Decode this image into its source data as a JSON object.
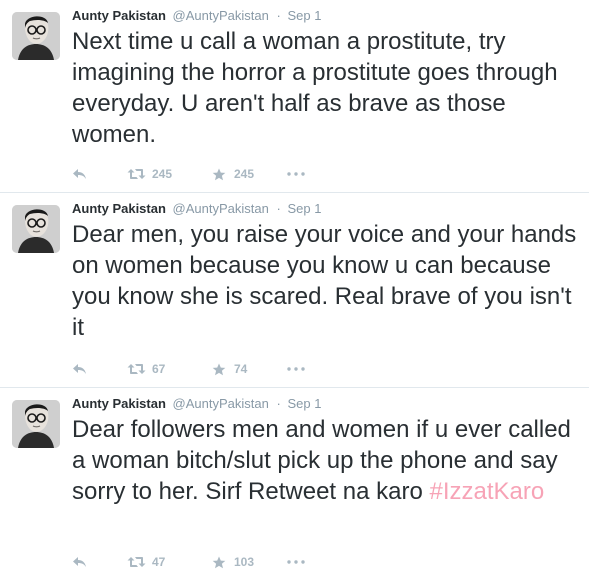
{
  "tweets": [
    {
      "fullname": "Aunty Pakistan",
      "username": "@AuntyPakistan",
      "separator": "·",
      "time": "Sep 1",
      "text": "Next time u call a woman a prostitute, try imagining the horror a prostitute goes through everyday. U aren't half as brave as those women.",
      "hashtag": "",
      "retweets": "245",
      "favorites": "245"
    },
    {
      "fullname": "Aunty Pakistan",
      "username": "@AuntyPakistan",
      "separator": "·",
      "time": "Sep 1",
      "text": "Dear men, you raise your voice and your hands on women because you know u can because you know she is scared. Real brave of you isn't it",
      "hashtag": "",
      "retweets": "67",
      "favorites": "74"
    },
    {
      "fullname": "Aunty Pakistan",
      "username": "@AuntyPakistan",
      "separator": "·",
      "time": "Sep 1",
      "text": "Dear followers men and women if u ever called a woman bitch/slut pick up the phone and say sorry to her. Sirf Retweet na karo ",
      "hashtag": "#IzzatKaro",
      "retweets": "47",
      "favorites": "103"
    }
  ],
  "icons": {
    "reply": "reply-icon",
    "retweet": "retweet-icon",
    "favorite": "star-icon",
    "more": "more-dots-icon"
  },
  "colors": {
    "text": "#292f33",
    "muted": "#8899a6",
    "action": "#aab8c2",
    "hashtag": "#f7a3b6",
    "divider": "#e1e8ed"
  }
}
